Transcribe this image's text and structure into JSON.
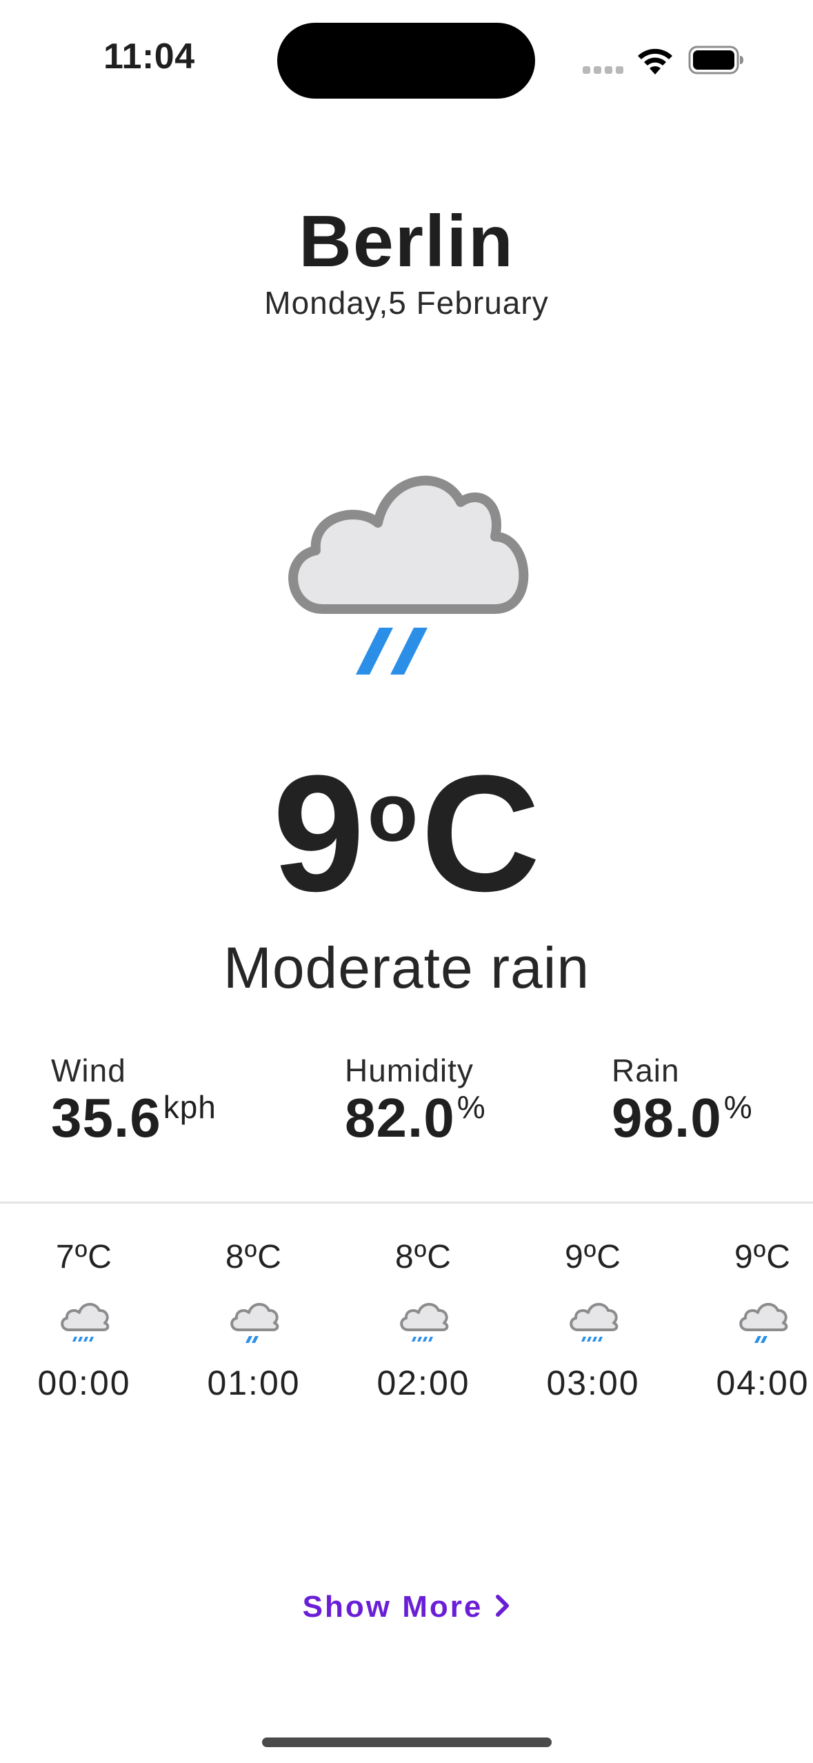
{
  "status_bar": {
    "time": "11:04"
  },
  "location": {
    "city": "Berlin",
    "date": "Monday,5 February"
  },
  "current": {
    "temperature": "9",
    "unit_symbol": "o",
    "unit": "C",
    "condition": "Moderate rain",
    "icon": "cloud-moderate-rain-icon"
  },
  "stats": {
    "wind": {
      "label": "Wind",
      "value": "35.6",
      "unit": "kph"
    },
    "humidity": {
      "label": "Humidity",
      "value": "82.0",
      "unit": "%"
    },
    "rain": {
      "label": "Rain",
      "value": "98.0",
      "unit": "%"
    }
  },
  "hourly": [
    {
      "temp": "7ºC",
      "time": "00:00",
      "icon": "cloud-heavy-rain-icon"
    },
    {
      "temp": "8ºC",
      "time": "01:00",
      "icon": "cloud-light-rain-icon"
    },
    {
      "temp": "8ºC",
      "time": "02:00",
      "icon": "cloud-heavy-rain-icon"
    },
    {
      "temp": "9ºC",
      "time": "03:00",
      "icon": "cloud-heavy-rain-icon"
    },
    {
      "temp": "9ºC",
      "time": "04:00",
      "icon": "cloud-light-rain-icon"
    }
  ],
  "show_more": {
    "label": "Show More"
  },
  "colors": {
    "accent": "#6a1fd6",
    "rain": "#2b8fe8",
    "cloud_fill": "#e6e6e8",
    "cloud_stroke": "#8c8c8c"
  }
}
